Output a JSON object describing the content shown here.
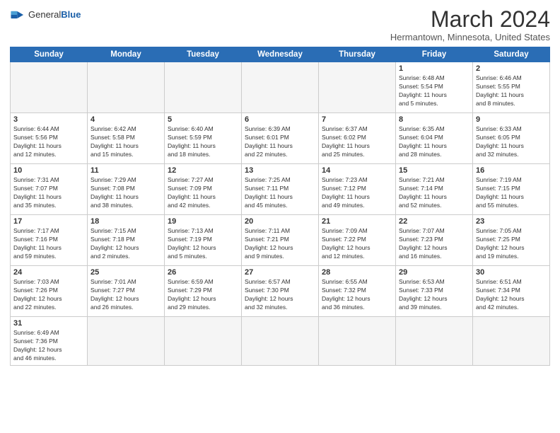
{
  "logo": {
    "text_general": "General",
    "text_blue": "Blue"
  },
  "header": {
    "title": "March 2024",
    "subtitle": "Hermantown, Minnesota, United States"
  },
  "weekdays": [
    "Sunday",
    "Monday",
    "Tuesday",
    "Wednesday",
    "Thursday",
    "Friday",
    "Saturday"
  ],
  "weeks": [
    [
      {
        "day": "",
        "info": ""
      },
      {
        "day": "",
        "info": ""
      },
      {
        "day": "",
        "info": ""
      },
      {
        "day": "",
        "info": ""
      },
      {
        "day": "",
        "info": ""
      },
      {
        "day": "1",
        "info": "Sunrise: 6:48 AM\nSunset: 5:54 PM\nDaylight: 11 hours\nand 5 minutes."
      },
      {
        "day": "2",
        "info": "Sunrise: 6:46 AM\nSunset: 5:55 PM\nDaylight: 11 hours\nand 8 minutes."
      }
    ],
    [
      {
        "day": "3",
        "info": "Sunrise: 6:44 AM\nSunset: 5:56 PM\nDaylight: 11 hours\nand 12 minutes."
      },
      {
        "day": "4",
        "info": "Sunrise: 6:42 AM\nSunset: 5:58 PM\nDaylight: 11 hours\nand 15 minutes."
      },
      {
        "day": "5",
        "info": "Sunrise: 6:40 AM\nSunset: 5:59 PM\nDaylight: 11 hours\nand 18 minutes."
      },
      {
        "day": "6",
        "info": "Sunrise: 6:39 AM\nSunset: 6:01 PM\nDaylight: 11 hours\nand 22 minutes."
      },
      {
        "day": "7",
        "info": "Sunrise: 6:37 AM\nSunset: 6:02 PM\nDaylight: 11 hours\nand 25 minutes."
      },
      {
        "day": "8",
        "info": "Sunrise: 6:35 AM\nSunset: 6:04 PM\nDaylight: 11 hours\nand 28 minutes."
      },
      {
        "day": "9",
        "info": "Sunrise: 6:33 AM\nSunset: 6:05 PM\nDaylight: 11 hours\nand 32 minutes."
      }
    ],
    [
      {
        "day": "10",
        "info": "Sunrise: 7:31 AM\nSunset: 7:07 PM\nDaylight: 11 hours\nand 35 minutes."
      },
      {
        "day": "11",
        "info": "Sunrise: 7:29 AM\nSunset: 7:08 PM\nDaylight: 11 hours\nand 38 minutes."
      },
      {
        "day": "12",
        "info": "Sunrise: 7:27 AM\nSunset: 7:09 PM\nDaylight: 11 hours\nand 42 minutes."
      },
      {
        "day": "13",
        "info": "Sunrise: 7:25 AM\nSunset: 7:11 PM\nDaylight: 11 hours\nand 45 minutes."
      },
      {
        "day": "14",
        "info": "Sunrise: 7:23 AM\nSunset: 7:12 PM\nDaylight: 11 hours\nand 49 minutes."
      },
      {
        "day": "15",
        "info": "Sunrise: 7:21 AM\nSunset: 7:14 PM\nDaylight: 11 hours\nand 52 minutes."
      },
      {
        "day": "16",
        "info": "Sunrise: 7:19 AM\nSunset: 7:15 PM\nDaylight: 11 hours\nand 55 minutes."
      }
    ],
    [
      {
        "day": "17",
        "info": "Sunrise: 7:17 AM\nSunset: 7:16 PM\nDaylight: 11 hours\nand 59 minutes."
      },
      {
        "day": "18",
        "info": "Sunrise: 7:15 AM\nSunset: 7:18 PM\nDaylight: 12 hours\nand 2 minutes."
      },
      {
        "day": "19",
        "info": "Sunrise: 7:13 AM\nSunset: 7:19 PM\nDaylight: 12 hours\nand 5 minutes."
      },
      {
        "day": "20",
        "info": "Sunrise: 7:11 AM\nSunset: 7:21 PM\nDaylight: 12 hours\nand 9 minutes."
      },
      {
        "day": "21",
        "info": "Sunrise: 7:09 AM\nSunset: 7:22 PM\nDaylight: 12 hours\nand 12 minutes."
      },
      {
        "day": "22",
        "info": "Sunrise: 7:07 AM\nSunset: 7:23 PM\nDaylight: 12 hours\nand 16 minutes."
      },
      {
        "day": "23",
        "info": "Sunrise: 7:05 AM\nSunset: 7:25 PM\nDaylight: 12 hours\nand 19 minutes."
      }
    ],
    [
      {
        "day": "24",
        "info": "Sunrise: 7:03 AM\nSunset: 7:26 PM\nDaylight: 12 hours\nand 22 minutes."
      },
      {
        "day": "25",
        "info": "Sunrise: 7:01 AM\nSunset: 7:27 PM\nDaylight: 12 hours\nand 26 minutes."
      },
      {
        "day": "26",
        "info": "Sunrise: 6:59 AM\nSunset: 7:29 PM\nDaylight: 12 hours\nand 29 minutes."
      },
      {
        "day": "27",
        "info": "Sunrise: 6:57 AM\nSunset: 7:30 PM\nDaylight: 12 hours\nand 32 minutes."
      },
      {
        "day": "28",
        "info": "Sunrise: 6:55 AM\nSunset: 7:32 PM\nDaylight: 12 hours\nand 36 minutes."
      },
      {
        "day": "29",
        "info": "Sunrise: 6:53 AM\nSunset: 7:33 PM\nDaylight: 12 hours\nand 39 minutes."
      },
      {
        "day": "30",
        "info": "Sunrise: 6:51 AM\nSunset: 7:34 PM\nDaylight: 12 hours\nand 42 minutes."
      }
    ],
    [
      {
        "day": "31",
        "info": "Sunrise: 6:49 AM\nSunset: 7:36 PM\nDaylight: 12 hours\nand 46 minutes."
      },
      {
        "day": "",
        "info": ""
      },
      {
        "day": "",
        "info": ""
      },
      {
        "day": "",
        "info": ""
      },
      {
        "day": "",
        "info": ""
      },
      {
        "day": "",
        "info": ""
      },
      {
        "day": "",
        "info": ""
      }
    ]
  ]
}
